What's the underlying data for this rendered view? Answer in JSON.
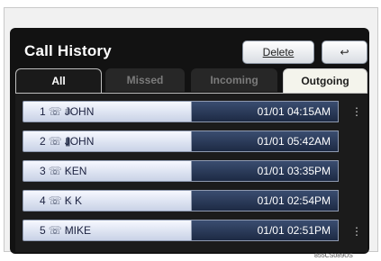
{
  "header": {
    "title": "Call History",
    "delete_label": "Delete",
    "back_symbol": "↩"
  },
  "tabs": [
    {
      "label": "All",
      "active": true
    },
    {
      "label": "Missed",
      "active": false
    },
    {
      "label": "Incoming",
      "active": false
    },
    {
      "label": "Outgoing",
      "active": false
    }
  ],
  "rows": [
    {
      "num": "1",
      "icons": "☏ ≡",
      "name": "JOHN",
      "time": "01/01 04:15AM"
    },
    {
      "num": "2",
      "icons": "☏ ▮",
      "name": "JOHN",
      "time": "01/01 05:42AM"
    },
    {
      "num": "3",
      "icons": "☏ ◌",
      "name": "KEN",
      "time": "01/01 03:35PM"
    },
    {
      "num": "4",
      "icons": "☏ ◌",
      "name": "K K",
      "time": "01/01 02:54PM"
    },
    {
      "num": "5",
      "icons": "☏ ◌",
      "name": "MIKE",
      "time": "01/01 02:51PM"
    }
  ],
  "scroll": {
    "up": "⋮",
    "down": "⋮"
  },
  "caption": "855CS089US"
}
